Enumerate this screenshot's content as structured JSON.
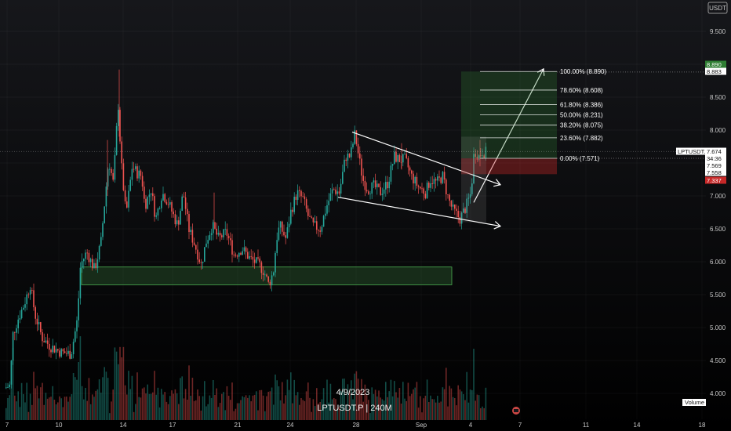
{
  "chart_data": {
    "type": "candlestick",
    "symbol": "LPTUSDT.P",
    "timeframe": "240M",
    "watermark_date": "4/9/2023",
    "currency": "USDT",
    "y_ticks": [
      "9.500",
      "9.000",
      "8.500",
      "8.000",
      "7.500",
      "7.000",
      "6.500",
      "6.000",
      "5.500",
      "5.000",
      "4.500",
      "4.000"
    ],
    "x_ticks": [
      "7",
      "10",
      "14",
      "17",
      "21",
      "24",
      "28",
      "Sep",
      "4",
      "7",
      "11",
      "14",
      "18"
    ],
    "ylim": [
      3.72,
      9.75
    ],
    "price_tags": [
      {
        "label": "8.890",
        "value": 8.89,
        "style": "green"
      },
      {
        "label": "8.883",
        "value": 8.883,
        "style": "white"
      },
      {
        "label": "LPTUSDT.P",
        "value": 7.674,
        "style": "symbol"
      },
      {
        "label": "7.674",
        "value": 7.674,
        "style": "white"
      },
      {
        "label": "34:36",
        "value": 7.62,
        "style": "white"
      },
      {
        "label": "7.569",
        "value": 7.569,
        "style": "white"
      },
      {
        "label": "7.558",
        "value": 7.558,
        "style": "white"
      },
      {
        "label": "7.337",
        "value": 7.337,
        "style": "red"
      }
    ],
    "fib_levels": [
      {
        "label": "100.00% (8.890)",
        "value": 8.89
      },
      {
        "label": "78.60% (8.608)",
        "value": 8.608
      },
      {
        "label": "61.80% (8.386)",
        "value": 8.386
      },
      {
        "label": "50.00% (8.231)",
        "value": 8.231
      },
      {
        "label": "38.20% (8.075)",
        "value": 8.075
      },
      {
        "label": "23.60% (7.882)",
        "value": 7.882
      },
      {
        "label": "0.00% (7.571)",
        "value": 7.571
      }
    ],
    "support_zone": {
      "top": 5.92,
      "bottom": 5.65
    },
    "volume_label": "Volume",
    "colors": {
      "up": "#26a69a",
      "down": "#ef5350",
      "zone": "#4caf50",
      "fib": "#ffffff"
    }
  }
}
